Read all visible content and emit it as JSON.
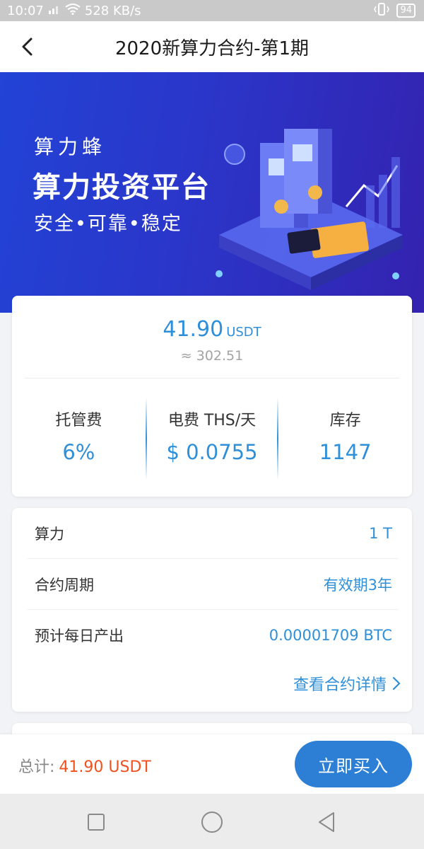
{
  "status_bar": {
    "time": "10:07",
    "network_speed": "528 KB/s",
    "battery": "94"
  },
  "nav": {
    "title": "2020新算力合约-第1期"
  },
  "banner": {
    "brand": "算力蜂",
    "headline": "算力投资平台",
    "tagline": "安全•可靠•稳定"
  },
  "price": {
    "value": "41.90",
    "unit": "USDT",
    "approx": "≈ 302.51"
  },
  "stats": [
    {
      "label": "托管费",
      "value": "6%"
    },
    {
      "label": "电费 THS/天",
      "value": "$ 0.0755"
    },
    {
      "label": "库存",
      "value": "1147"
    }
  ],
  "info": [
    {
      "key": "算力",
      "value": "1 T"
    },
    {
      "key": "合约周期",
      "value": "有效期3年"
    },
    {
      "key": "预计每日产出",
      "value": "0.00001709 BTC"
    }
  ],
  "details_link": "查看合约详情",
  "bottom": {
    "total_label": "总计:",
    "total_amount": "41.90 USDT",
    "buy_label": "立即买入"
  },
  "colors": {
    "accent": "#2f8fd8",
    "button": "#2d7fd6",
    "total": "#f0521f",
    "banner_start": "#2243d6",
    "banner_end": "#3422b0"
  },
  "icons": [
    "back-arrow-icon",
    "chevron-right-icon",
    "wifi-icon",
    "signal-icon",
    "vibrate-icon",
    "square-nav-icon",
    "circle-nav-icon",
    "triangle-back-nav-icon"
  ]
}
